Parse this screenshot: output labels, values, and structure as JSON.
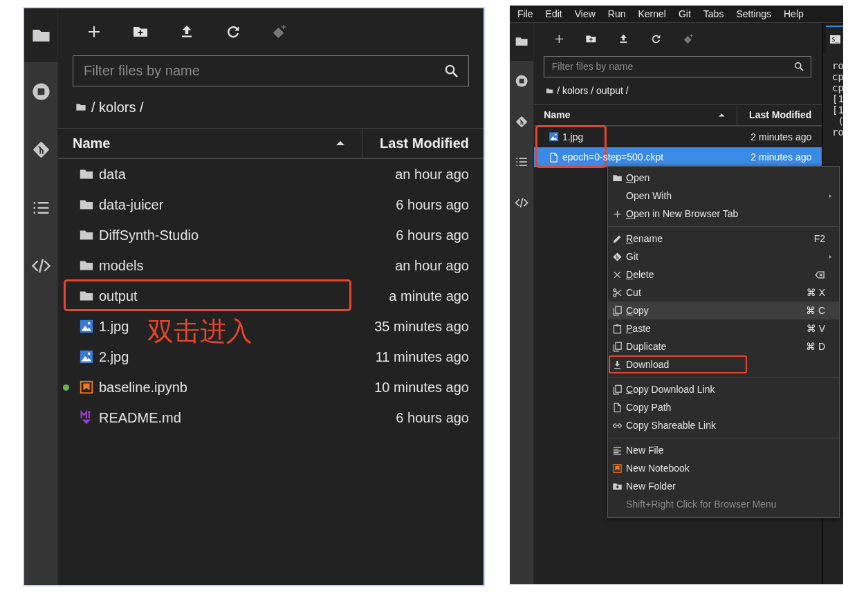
{
  "left_panel": {
    "filter": {
      "placeholder": "Filter files by name"
    },
    "breadcrumb": "/ kolors /",
    "columns": [
      {
        "label": "Name",
        "sorted": true
      },
      {
        "label": "Last Modified",
        "sorted": false
      }
    ],
    "files": [
      {
        "name": "data",
        "kind": "folder",
        "modified": "an hour ago",
        "selected": false,
        "annotated": false,
        "running": false
      },
      {
        "name": "data-juicer",
        "kind": "folder",
        "modified": "6 hours ago",
        "selected": false,
        "annotated": false,
        "running": false
      },
      {
        "name": "DiffSynth-Studio",
        "kind": "folder",
        "modified": "6 hours ago",
        "selected": false,
        "annotated": false,
        "running": false
      },
      {
        "name": "models",
        "kind": "folder",
        "modified": "an hour ago",
        "selected": false,
        "annotated": false,
        "running": false
      },
      {
        "name": "output",
        "kind": "folder",
        "modified": "a minute ago",
        "selected": false,
        "annotated": true,
        "running": false
      },
      {
        "name": "1.jpg",
        "kind": "image",
        "modified": "35 minutes ago",
        "selected": false,
        "annotated": false,
        "running": false
      },
      {
        "name": "2.jpg",
        "kind": "image",
        "modified": "11 minutes ago",
        "selected": false,
        "annotated": false,
        "running": false
      },
      {
        "name": "baseline.ipynb",
        "kind": "notebook",
        "modified": "10 minutes ago",
        "selected": false,
        "annotated": false,
        "running": true
      },
      {
        "name": "README.md",
        "kind": "markdown",
        "modified": "6 hours ago",
        "selected": false,
        "annotated": false,
        "running": false
      }
    ],
    "annotation": {
      "text": "双击进入"
    }
  },
  "right_panel": {
    "menu_bar": [
      "File",
      "Edit",
      "View",
      "Run",
      "Kernel",
      "Git",
      "Tabs",
      "Settings",
      "Help"
    ],
    "filter": {
      "placeholder": "Filter files by name"
    },
    "breadcrumb": "/ kolors / output /",
    "columns": [
      {
        "label": "Name",
        "sorted": true
      },
      {
        "label": "Last Modified",
        "sorted": false
      }
    ],
    "files": [
      {
        "name": "1.jpg",
        "kind": "image",
        "modified": "2 minutes ago",
        "selected": false,
        "annotated": true,
        "running": false
      },
      {
        "name": "epoch=0-step=500.ckpt",
        "kind": "file",
        "modified": "2 minutes ago",
        "selected": true,
        "annotated": true,
        "running": false
      }
    ],
    "terminal": {
      "tab_icon": "$_",
      "lines": [
        "ro",
        "cp",
        "cp",
        "[1",
        "[1",
        " (",
        "ro"
      ]
    },
    "context_menu": {
      "groups": [
        [
          {
            "label": "Open",
            "underline_first": true,
            "submenu": false,
            "hovered": false,
            "annotated": false
          },
          {
            "label": "Open With",
            "underline_first": false,
            "submenu": true,
            "hovered": false,
            "annotated": false
          },
          {
            "label": "Open in New Browser Tab",
            "underline_first": true,
            "submenu": false,
            "hovered": false,
            "annotated": false
          }
        ],
        [
          {
            "label": "Rename",
            "underline_first": true,
            "shortcut": "F2",
            "submenu": false,
            "hovered": false,
            "annotated": false
          },
          {
            "label": "Git",
            "underline_first": false,
            "submenu": true,
            "hovered": false,
            "annotated": false
          },
          {
            "label": "Delete",
            "underline_first": true,
            "submenu": false,
            "hovered": false,
            "annotated": false
          },
          {
            "label": "Cut",
            "underline_first": false,
            "shortcut": "⌘ X",
            "submenu": false,
            "hovered": false,
            "annotated": false
          },
          {
            "label": "Copy",
            "underline_first": true,
            "shortcut": "⌘ C",
            "submenu": false,
            "hovered": true,
            "annotated": false
          },
          {
            "label": "Paste",
            "underline_first": true,
            "shortcut": "⌘ V",
            "submenu": false,
            "hovered": false,
            "annotated": false
          },
          {
            "label": "Duplicate",
            "underline_first": false,
            "shortcut": "⌘ D",
            "submenu": false,
            "hovered": false,
            "annotated": false
          },
          {
            "label": "Download",
            "underline_first": false,
            "submenu": false,
            "hovered": false,
            "annotated": true
          }
        ],
        [
          {
            "label": "Copy Download Link",
            "underline_first": true,
            "submenu": false,
            "hovered": false,
            "annotated": false
          },
          {
            "label": "Copy Path",
            "underline_first": false,
            "submenu": false,
            "hovered": false,
            "annotated": false
          },
          {
            "label": "Copy Shareable Link",
            "underline_first": false,
            "submenu": false,
            "hovered": false,
            "annotated": false
          }
        ],
        [
          {
            "label": "New File",
            "underline_first": false,
            "submenu": false,
            "hovered": false,
            "annotated": false
          },
          {
            "label": "New Notebook",
            "underline_first": false,
            "submenu": false,
            "hovered": false,
            "annotated": false
          },
          {
            "label": "New Folder",
            "underline_first": false,
            "submenu": false,
            "hovered": false,
            "annotated": false
          }
        ]
      ],
      "hint": "Shift+Right Click for Browser Menu"
    }
  }
}
